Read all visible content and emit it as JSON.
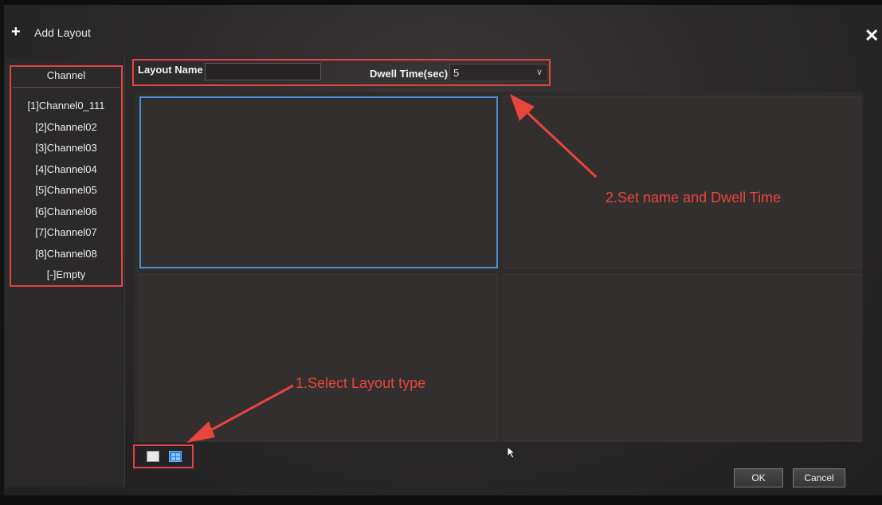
{
  "window": {
    "title": "Add Layout",
    "plus_glyph": "+",
    "close_glyph": "✕"
  },
  "channel_panel": {
    "header": "Channel",
    "items": [
      "[1]Channel0_111",
      "[2]Channel02",
      "[3]Channel03",
      "[4]Channel04",
      "[5]Channel05",
      "[6]Channel06",
      "[7]Channel07",
      "[8]Channel08",
      "[-]Empty"
    ]
  },
  "form": {
    "layout_name_label": "Layout Name",
    "layout_name_value": "",
    "dwell_time_label": "Dwell Time(sec)",
    "dwell_time_value": "5"
  },
  "preview": {
    "layout": "4-pane grid",
    "selected_pane": 1
  },
  "layout_types": [
    "single-view-icon",
    "quad-view-icon"
  ],
  "buttons": {
    "ok": "OK",
    "cancel": "Cancel"
  },
  "annotations": {
    "step1": "1.Select Layout type",
    "step2": "2.Set name and Dwell Time"
  },
  "colors": {
    "annotation_red": "#e04444",
    "selection_blue": "#4a90d9",
    "active_layout_blue": "#2b7de0"
  }
}
